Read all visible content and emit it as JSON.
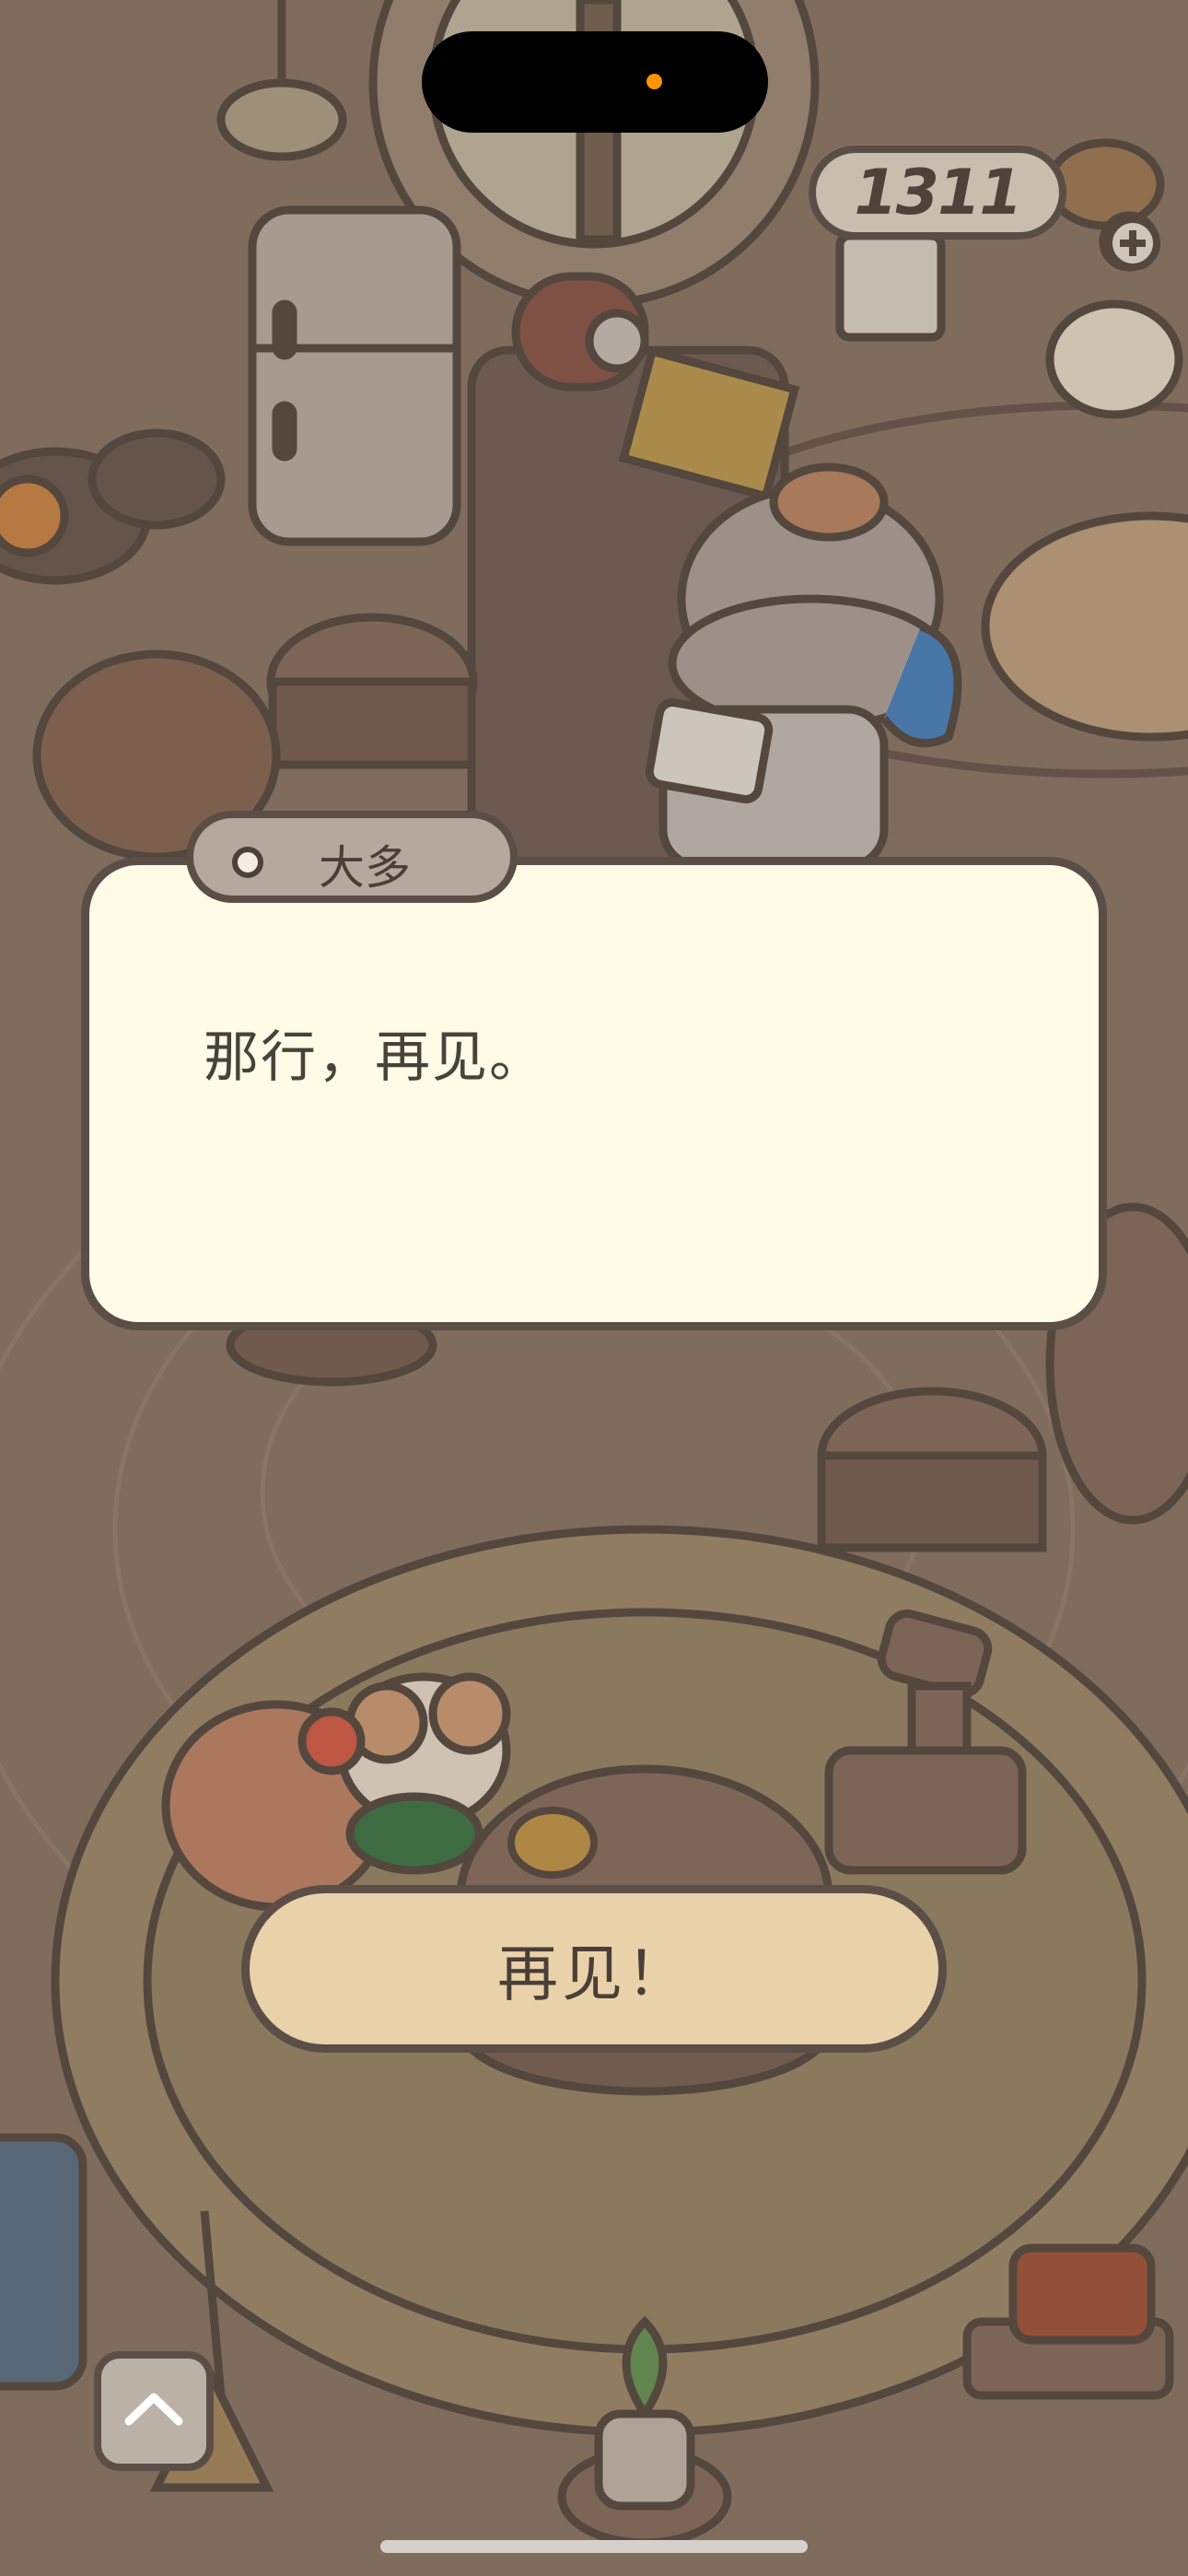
{
  "hud": {
    "currency_value": "1311"
  },
  "dialog": {
    "speaker_name": "大多",
    "message": "那行，再见。"
  },
  "reply": {
    "label": "再见！"
  },
  "controls": {
    "up_button_icon": "chevron-up-icon",
    "add_currency_icon": "plus-icon"
  }
}
